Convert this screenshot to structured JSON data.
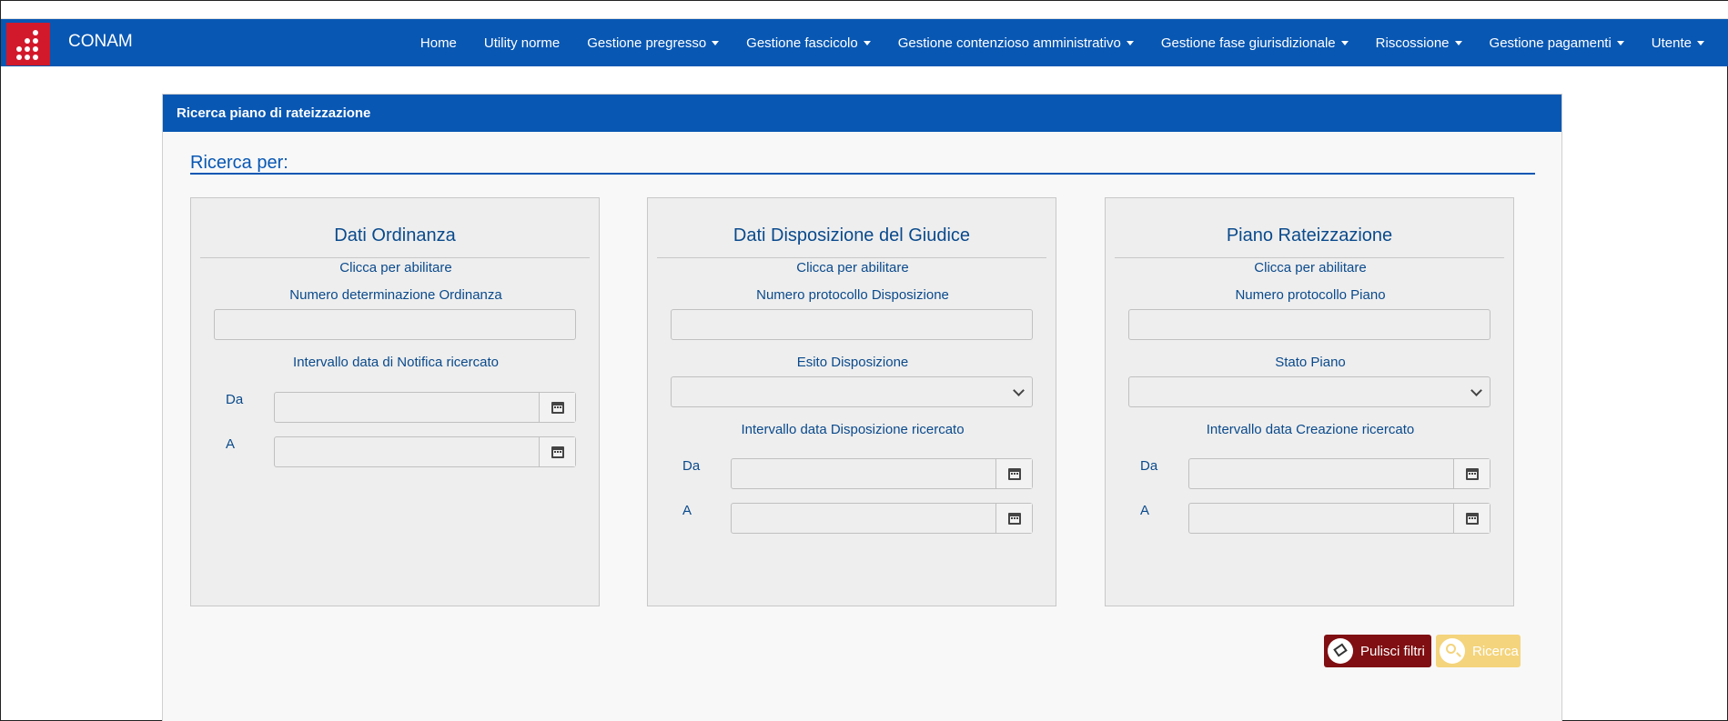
{
  "app": {
    "brand": "CONAM"
  },
  "nav": {
    "items": [
      {
        "label": "Home",
        "dropdown": false
      },
      {
        "label": "Utility norme",
        "dropdown": false
      },
      {
        "label": "Gestione pregresso",
        "dropdown": true
      },
      {
        "label": "Gestione fascicolo",
        "dropdown": true
      },
      {
        "label": "Gestione contenzioso amministrativo",
        "dropdown": true
      },
      {
        "label": "Gestione fase giurisdizionale",
        "dropdown": true
      },
      {
        "label": "Riscossione",
        "dropdown": true
      },
      {
        "label": "Gestione pagamenti",
        "dropdown": true
      },
      {
        "label": "Utente",
        "dropdown": true
      }
    ]
  },
  "panel": {
    "header": "Ricerca piano di rateizzazione",
    "section_title": "Ricerca per:"
  },
  "cards": [
    {
      "title": "Dati Ordinanza",
      "enable_hint": "Clicca per abilitare",
      "field_label": "Numero determinazione Ordinanza",
      "field_value": "",
      "range_label": "Intervallo data di Notifica ricercato",
      "from_label": "Da",
      "to_label": "A"
    },
    {
      "title": "Dati Disposizione del Giudice",
      "enable_hint": "Clicca per abilitare",
      "field_label": "Numero protocollo Disposizione",
      "field_value": "",
      "select_label": "Esito Disposizione",
      "select_value": "",
      "range_label": "Intervallo data Disposizione ricercato",
      "from_label": "Da",
      "to_label": "A"
    },
    {
      "title": "Piano Rateizzazione",
      "enable_hint": "Clicca per abilitare",
      "field_label": "Numero protocollo Piano",
      "field_value": "",
      "select_label": "Stato Piano",
      "select_value": "",
      "range_label": "Intervallo data Creazione ricercato",
      "from_label": "Da",
      "to_label": "A"
    }
  ],
  "buttons": {
    "clear_label": "Pulisci filtri",
    "search_label": "Ricerca"
  },
  "icons": {
    "calendar": "calendar-icon",
    "chevron": "chevron-down-icon",
    "eraser": "eraser-icon",
    "search": "search-icon"
  },
  "colors": {
    "brand_blue": "#0857b3",
    "logo_red": "#d2192b",
    "clear_button": "#7f0f12",
    "search_button": "#f4d47c"
  }
}
